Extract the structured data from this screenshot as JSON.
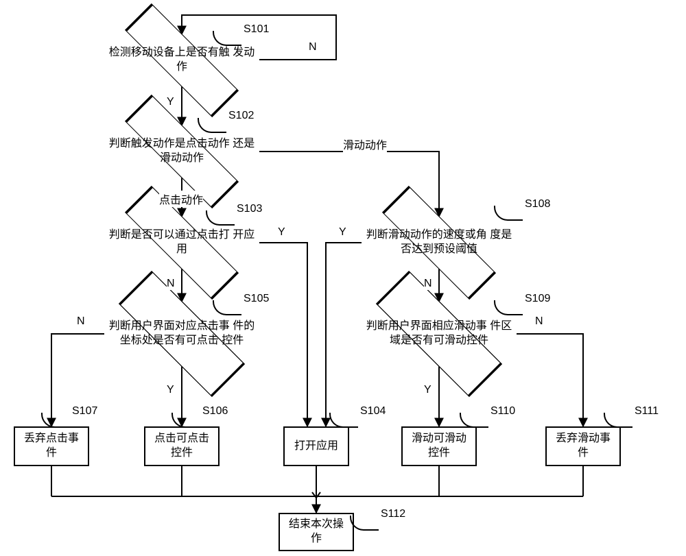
{
  "steps": {
    "s101": {
      "id": "S101",
      "text": "检测移动设备上是否有触\n发动作"
    },
    "s102": {
      "id": "S102",
      "text": "判断触发动作是点击动作\n还是滑动动作"
    },
    "s103": {
      "id": "S103",
      "text": "判断是否可以通过点击打\n开应用"
    },
    "s104": {
      "id": "S104",
      "text": "打开应用"
    },
    "s105": {
      "id": "S105",
      "text": "判断用户界面对应点击事\n件的坐标处是否有可点击\n控件"
    },
    "s106": {
      "id": "S106",
      "text": "点击可点击\n控件"
    },
    "s107": {
      "id": "S107",
      "text": "丢弃点击事\n件"
    },
    "s108": {
      "id": "S108",
      "text": "判断滑动动作的速度或角\n度是否达到预设阈值"
    },
    "s109": {
      "id": "S109",
      "text": "判断用户界面相应滑动事\n件区域是否有可滑动控件"
    },
    "s110": {
      "id": "S110",
      "text": "滑动可滑动\n控件"
    },
    "s111": {
      "id": "S111",
      "text": "丢弃滑动事\n件"
    },
    "s112": {
      "id": "S112",
      "text": "结束本次操\n作"
    }
  },
  "edgeLabels": {
    "yes": "Y",
    "no": "N",
    "click_action": "点击动作",
    "slide_action": "滑动动作"
  }
}
